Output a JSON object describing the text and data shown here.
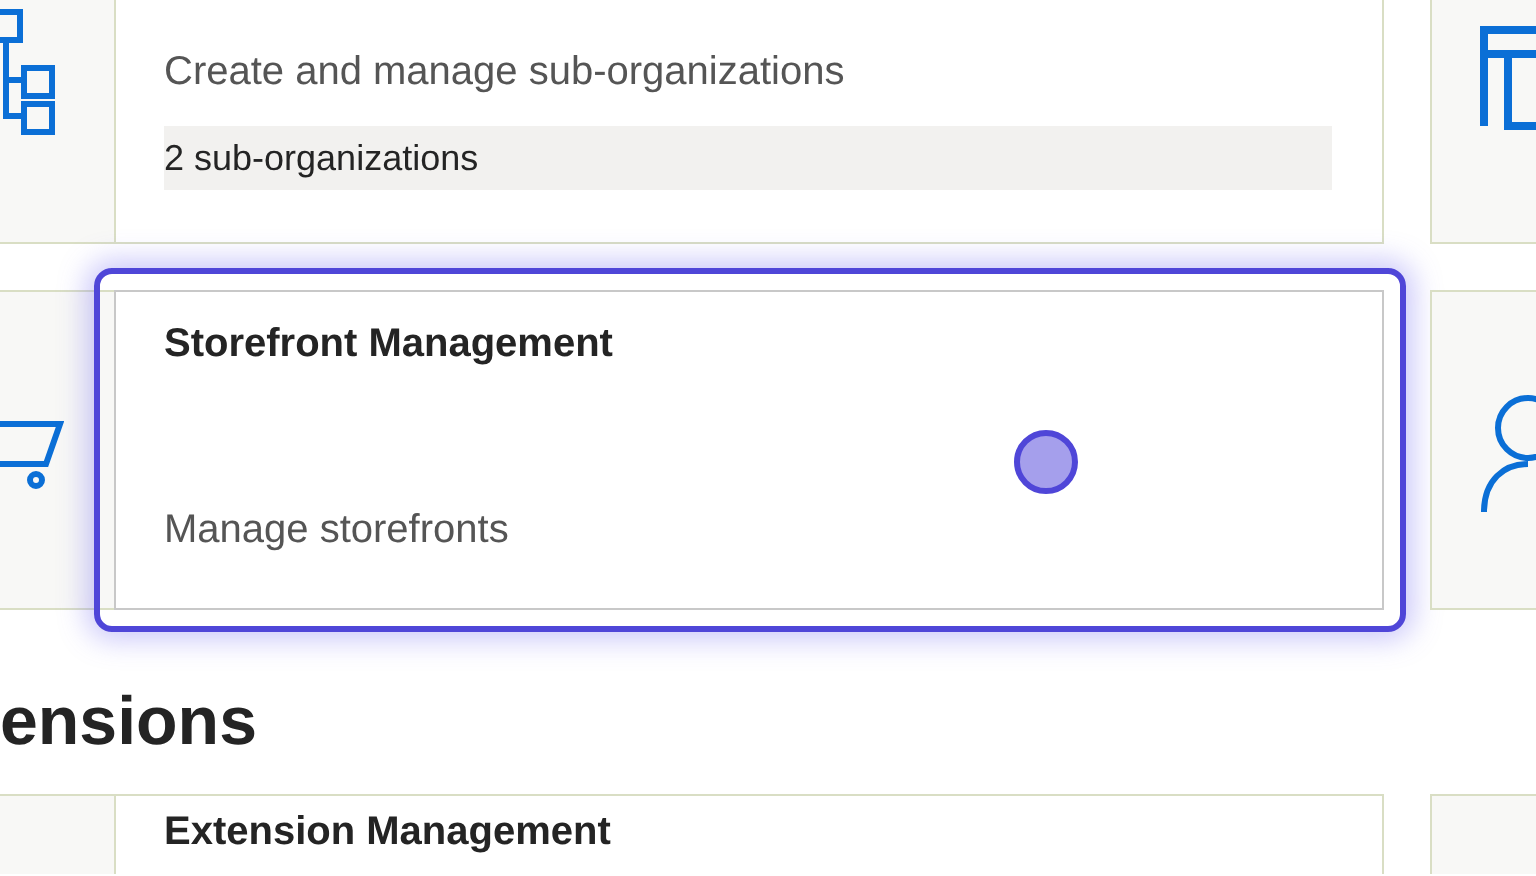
{
  "cards": [
    {
      "description": "Create and manage sub-organizations",
      "badge": "2 sub-organizations",
      "selected": false
    },
    {
      "title": "Storefront Management",
      "description": "Manage storefronts",
      "selected": true
    }
  ],
  "section": {
    "heading": "ensions"
  },
  "extension_cards": [
    {
      "title": "Extension Management",
      "selected": false
    }
  ]
}
